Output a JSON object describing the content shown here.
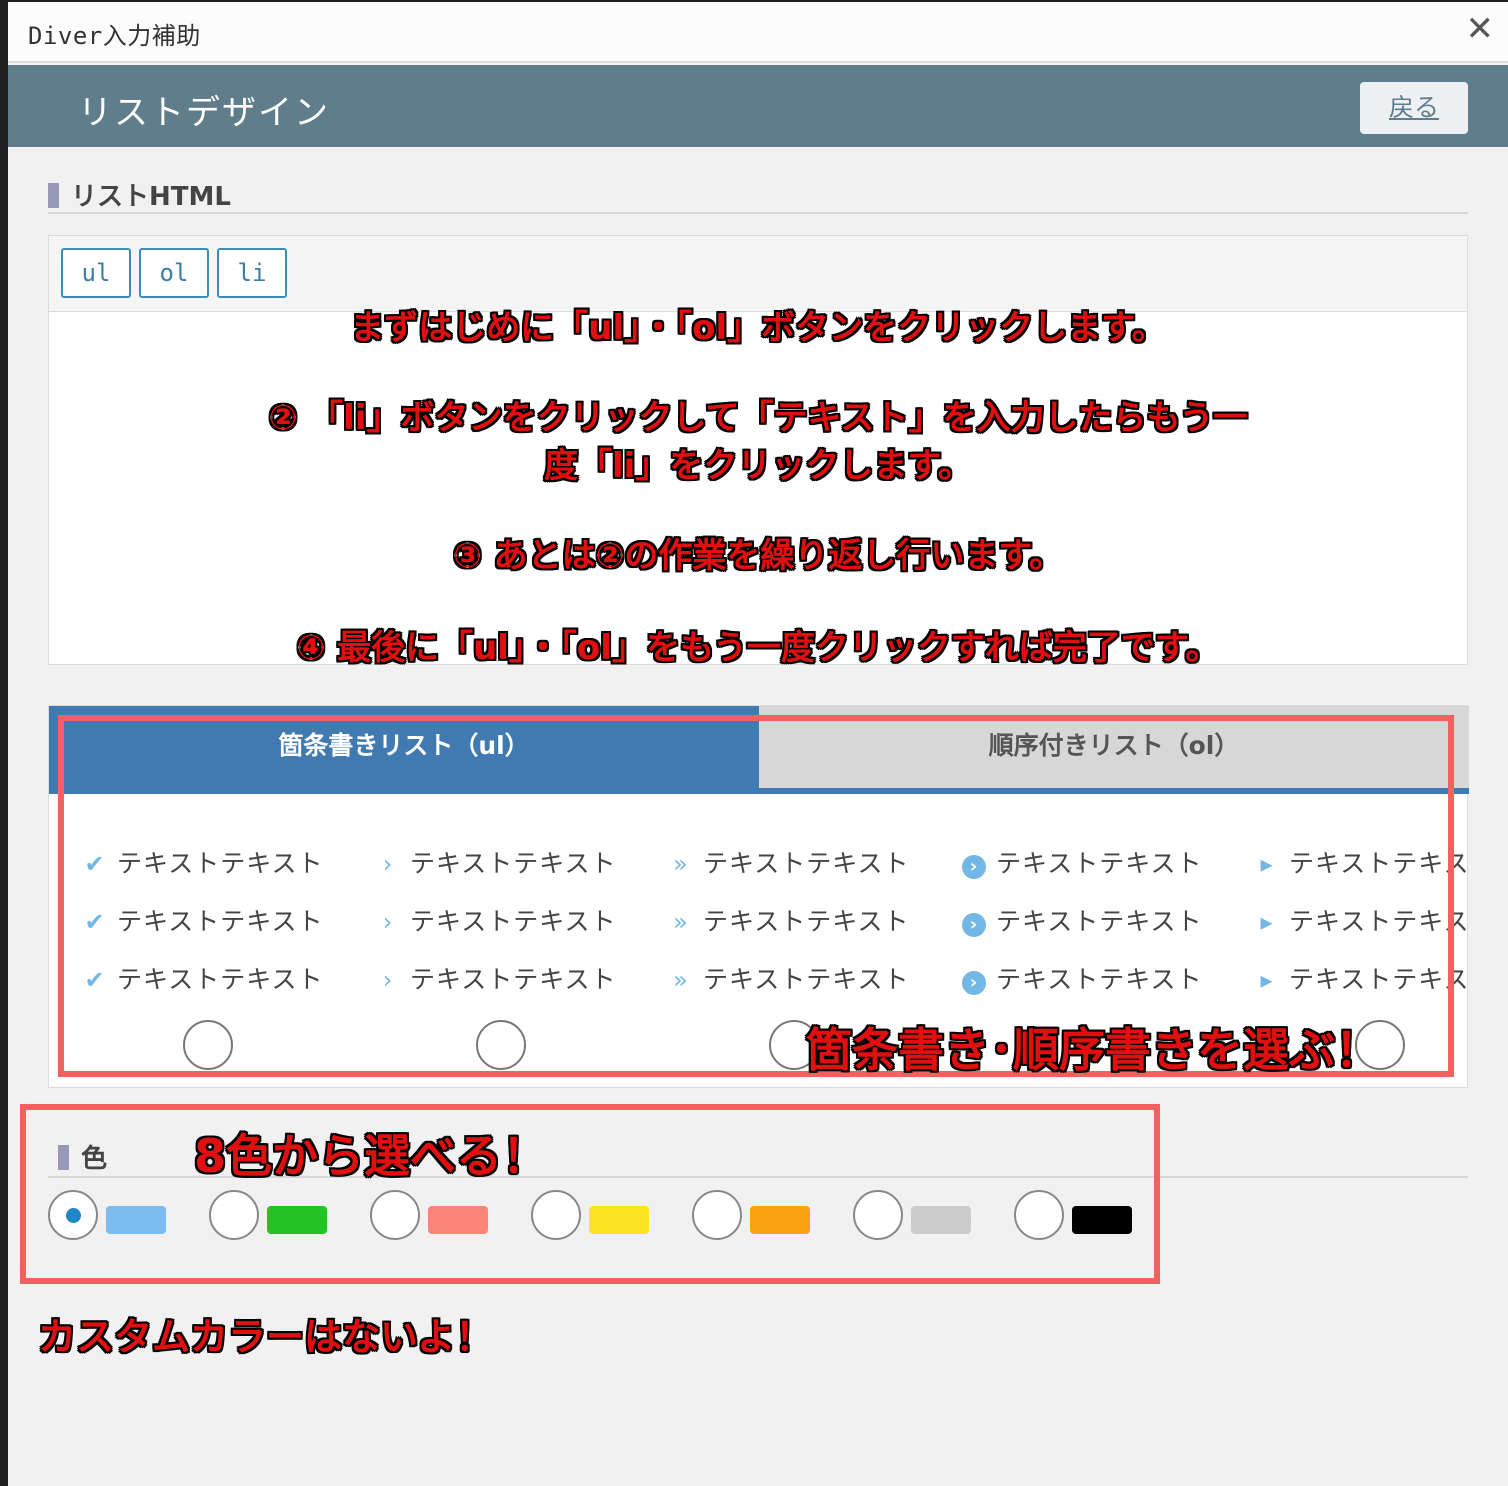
{
  "window": {
    "title": "Diver入力補助",
    "close_glyph": "✕"
  },
  "header": {
    "title": "リストデザイン",
    "back_label": "戻る"
  },
  "html_section": {
    "title": "リストHTML"
  },
  "tag_buttons": [
    {
      "label": "ul"
    },
    {
      "label": "ol"
    },
    {
      "label": "li"
    }
  ],
  "annotations": {
    "step1": "まずはじめに「ul」・「ol」ボタンをクリックします。",
    "step2a": "② 「li」ボタンをクリックして「テキスト」を入力したらもう一",
    "step2b": "度「li」をクリックします。",
    "step3": "③ あとは②の作業を繰り返し行います。",
    "step4": "④ 最後に「ul」・「ol」をもう一度クリックすれば完了です。",
    "choose_list": "箇条書き･順序書きを選ぶ！",
    "eight_colors": "8色から選べる！",
    "no_custom": "カスタムカラーはないよ！"
  },
  "list_tabs": {
    "ul": "箇条書きリスト（ul）",
    "ol": "順序付きリスト（ol）"
  },
  "list_styles": [
    {
      "icon": "check-icon",
      "glyph": "✔",
      "items": [
        "テキストテキスト",
        "テキストテキスト",
        "テキストテキスト"
      ]
    },
    {
      "icon": "chevron-right-icon",
      "glyph": "›",
      "items": [
        "テキストテキスト",
        "テキストテキスト",
        "テキストテキスト"
      ]
    },
    {
      "icon": "double-chevron-icon",
      "glyph": "»",
      "items": [
        "テキストテキスト",
        "テキストテキスト",
        "テキストテキスト"
      ]
    },
    {
      "icon": "circle-chevron-icon",
      "glyph": "›",
      "items": [
        "テキストテキスト",
        "テキストテキスト",
        "テキストテキスト"
      ]
    },
    {
      "icon": "triangle-right-icon",
      "glyph": "▸",
      "items": [
        "テキストテキスト",
        "テキストテキスト",
        "テキストテキスト"
      ]
    }
  ],
  "color_section": {
    "title": "色"
  },
  "colors": [
    {
      "hex": "#7cbcf0",
      "selected": true
    },
    {
      "hex": "#22c322",
      "selected": false
    },
    {
      "hex": "#fc8579",
      "selected": false
    },
    {
      "hex": "#fde421",
      "selected": false
    },
    {
      "hex": "#fba212",
      "selected": false
    },
    {
      "hex": "#cacaca",
      "selected": false
    },
    {
      "hex": "#000000",
      "selected": false
    }
  ]
}
